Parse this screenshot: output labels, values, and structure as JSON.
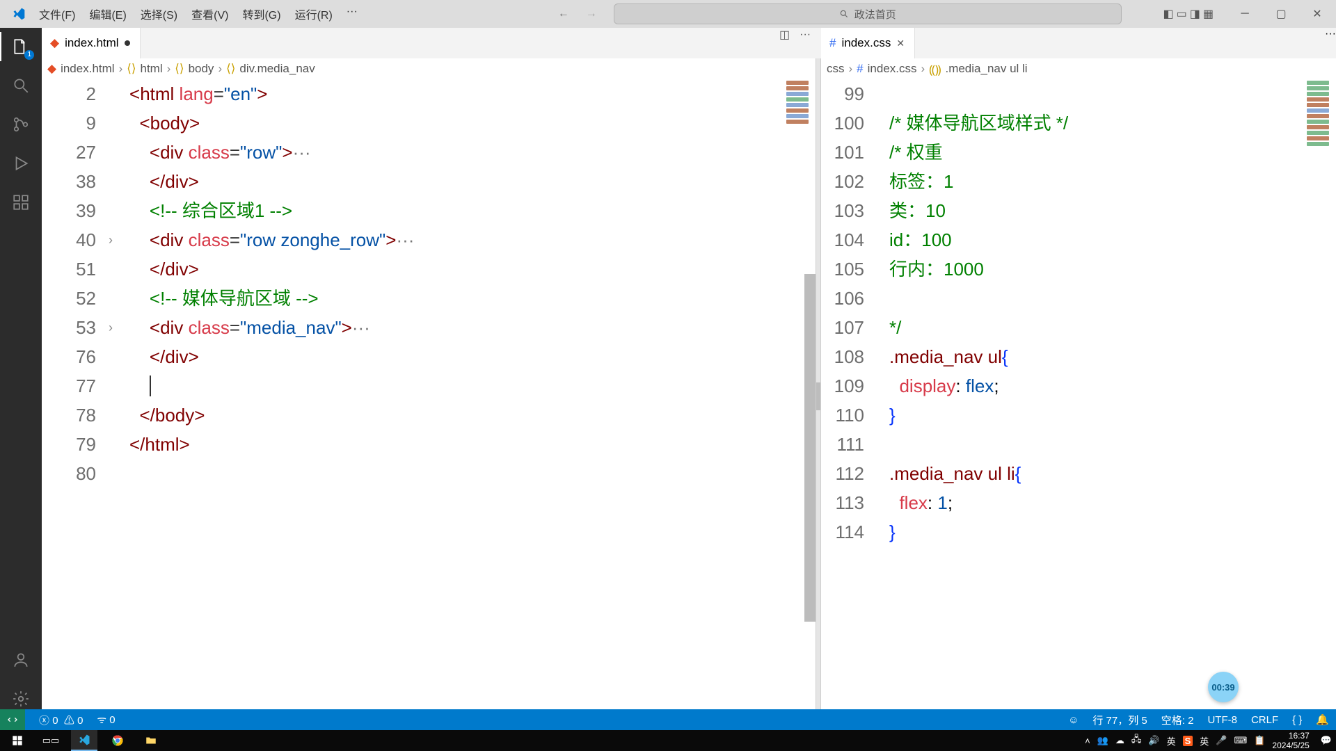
{
  "menu": {
    "file": "文件(F)",
    "edit": "编辑(E)",
    "select": "选择(S)",
    "view": "查看(V)",
    "goto": "转到(G)",
    "run": "运行(R)",
    "more": "···"
  },
  "search_placeholder": "政法首页",
  "activity_badge": "1",
  "tabs": {
    "left": {
      "name": "index.html",
      "modified": true
    },
    "right": {
      "name": "index.css",
      "closable": true
    }
  },
  "breadcrumb_left": [
    "index.html",
    "html",
    "body",
    "div.media_nav"
  ],
  "breadcrumb_right": [
    "css",
    "index.css",
    ".media_nav ul li"
  ],
  "left_editor": {
    "lines": [
      {
        "num": 2,
        "indent": 0,
        "html": "<span class='c-delim'>&lt;</span><span class='c-tag'>html</span> <span class='c-attr'>lang</span><span class='c-eq'>=</span><span class='c-str'>\"en\"</span><span class='c-delim'>&gt;</span>"
      },
      {
        "num": 9,
        "indent": 1,
        "html": "<span class='c-delim'>&lt;</span><span class='c-tag'>body</span><span class='c-delim'>&gt;</span>"
      },
      {
        "num": 27,
        "indent": 2,
        "html": "<span class='c-delim'>&lt;</span><span class='c-tag'>div</span> <span class='c-attr'>class</span><span class='c-eq'>=</span><span class='c-str'>\"row\"</span><span class='c-delim'>&gt;</span><span class='c-fold'>···</span>"
      },
      {
        "num": 38,
        "indent": 2,
        "html": "<span class='c-delim'>&lt;/</span><span class='c-tag'>div</span><span class='c-delim'>&gt;</span>"
      },
      {
        "num": 39,
        "indent": 2,
        "html": "<span class='c-cmt'>&lt;!-- 综合区域1 --&gt;</span>"
      },
      {
        "num": 40,
        "indent": 2,
        "fold": true,
        "html": "<span class='c-delim'>&lt;</span><span class='c-tag'>div</span> <span class='c-attr'>class</span><span class='c-eq'>=</span><span class='c-str'>\"row zonghe_row\"</span><span class='c-delim'>&gt;</span><span class='c-fold'>···</span>"
      },
      {
        "num": 51,
        "indent": 2,
        "html": "<span class='c-delim'>&lt;/</span><span class='c-tag'>div</span><span class='c-delim'>&gt;</span>"
      },
      {
        "num": 52,
        "indent": 2,
        "html": "<span class='c-cmt'>&lt;!-- 媒体导航区域 --&gt;</span>"
      },
      {
        "num": 53,
        "indent": 2,
        "fold": true,
        "html": "<span class='c-delim'>&lt;</span><span class='c-tag'>div</span> <span class='c-attr'>class</span><span class='c-eq'>=</span><span class='c-str'>\"media_nav\"</span><span class='c-delim'>&gt;</span><span class='c-fold'>···</span>"
      },
      {
        "num": 76,
        "indent": 2,
        "html": "<span class='c-delim'>&lt;/</span><span class='c-tag'>div</span><span class='c-delim'>&gt;</span>"
      },
      {
        "num": 77,
        "indent": 2,
        "html": "<span class='caret'></span>"
      },
      {
        "num": 78,
        "indent": 1,
        "html": "<span class='c-delim'>&lt;/</span><span class='c-tag'>body</span><span class='c-delim'>&gt;</span>"
      },
      {
        "num": 79,
        "indent": 0,
        "html": "<span class='c-delim'>&lt;/</span><span class='c-tag'>html</span><span class='c-delim'>&gt;</span>"
      },
      {
        "num": 80,
        "indent": 0,
        "html": ""
      }
    ]
  },
  "right_editor": {
    "lines": [
      {
        "num": 99,
        "html": ""
      },
      {
        "num": 100,
        "html": "<span class='c-cmt'>/* 媒体导航区域样式 */</span>"
      },
      {
        "num": 101,
        "html": "<span class='c-cmt'>/* 权重</span>"
      },
      {
        "num": 102,
        "html": "<span class='c-cmt'>标签：1</span>"
      },
      {
        "num": 103,
        "html": "<span class='c-cmt'>类：10</span>"
      },
      {
        "num": 104,
        "html": "<span class='c-cmt'>id：100</span>"
      },
      {
        "num": 105,
        "html": "<span class='c-cmt'>行内：1000</span>"
      },
      {
        "num": 106,
        "html": ""
      },
      {
        "num": 107,
        "html": "<span class='c-cmt'>*/</span>"
      },
      {
        "num": 108,
        "html": "<span class='c-sel'>.media_nav ul</span><span class='c-brace'>{</span>"
      },
      {
        "num": 109,
        "html": "  <span class='c-prop'>display</span>: <span class='c-val'>flex</span>;"
      },
      {
        "num": 110,
        "html": "<span class='c-brace'>}</span>"
      },
      {
        "num": 111,
        "html": ""
      },
      {
        "num": 112,
        "html": "<span class='c-sel'>.media_nav ul li</span><span class='c-brace'>{</span>"
      },
      {
        "num": 113,
        "html": "  <span class='c-prop'>flex</span>: <span class='c-val'>1</span>;"
      },
      {
        "num": 114,
        "html": "<span class='c-brace'>}</span>"
      }
    ]
  },
  "status": {
    "errors": "0",
    "warnings": "0",
    "port": "0",
    "cursor": "行 77，列 5",
    "spaces": "空格: 2",
    "encoding": "UTF-8",
    "eol": "CRLF",
    "lang": "{ }",
    "ime": "英",
    "more": ", ·"
  },
  "taskbar": {
    "time": "16:37",
    "date": "2024/5/25",
    "ime_label": "英"
  },
  "float_badge": "00:39"
}
